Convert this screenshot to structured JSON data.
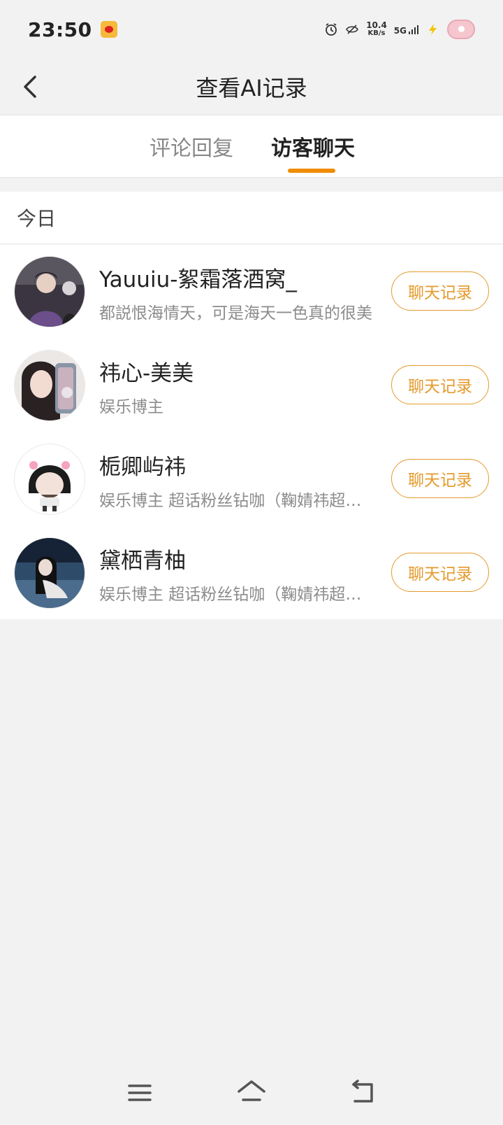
{
  "status_bar": {
    "time": "23:50",
    "net_speed_value": "10.4",
    "net_speed_unit": "KB/s",
    "network": "5G",
    "icons": [
      "weibo-icon",
      "alarm-icon",
      "eye-off-icon",
      "signal-icon",
      "charging-icon",
      "donut-avatar-icon"
    ]
  },
  "header": {
    "title": "查看AI记录",
    "back_icon": "chevron-left-icon"
  },
  "tabs": [
    {
      "label": "评论回复",
      "active": false
    },
    {
      "label": "访客聊天",
      "active": true
    }
  ],
  "section": {
    "label": "今日"
  },
  "list": [
    {
      "name": "Yauuiu-絮霜落酒窝_",
      "desc": "都説恨海情天，可是海天一色真的很美",
      "button": "聊天记录"
    },
    {
      "name": "祎心-美美",
      "desc": "娱乐博主",
      "button": "聊天记录"
    },
    {
      "name": "栀卿屿祎",
      "desc": "娱乐博主 超话粉丝钻咖（鞠婧祎超话）",
      "button": "聊天记录"
    },
    {
      "name": "黛栖青柚",
      "desc": "娱乐博主 超话粉丝钻咖（鞠婧祎超话）",
      "button": "聊天记录"
    }
  ],
  "bottom_nav": [
    "menu-icon",
    "home-icon",
    "back-icon"
  ],
  "colors": {
    "accent": "#f08c00",
    "button_border": "#e59a2c",
    "background": "#f2f2f2"
  }
}
